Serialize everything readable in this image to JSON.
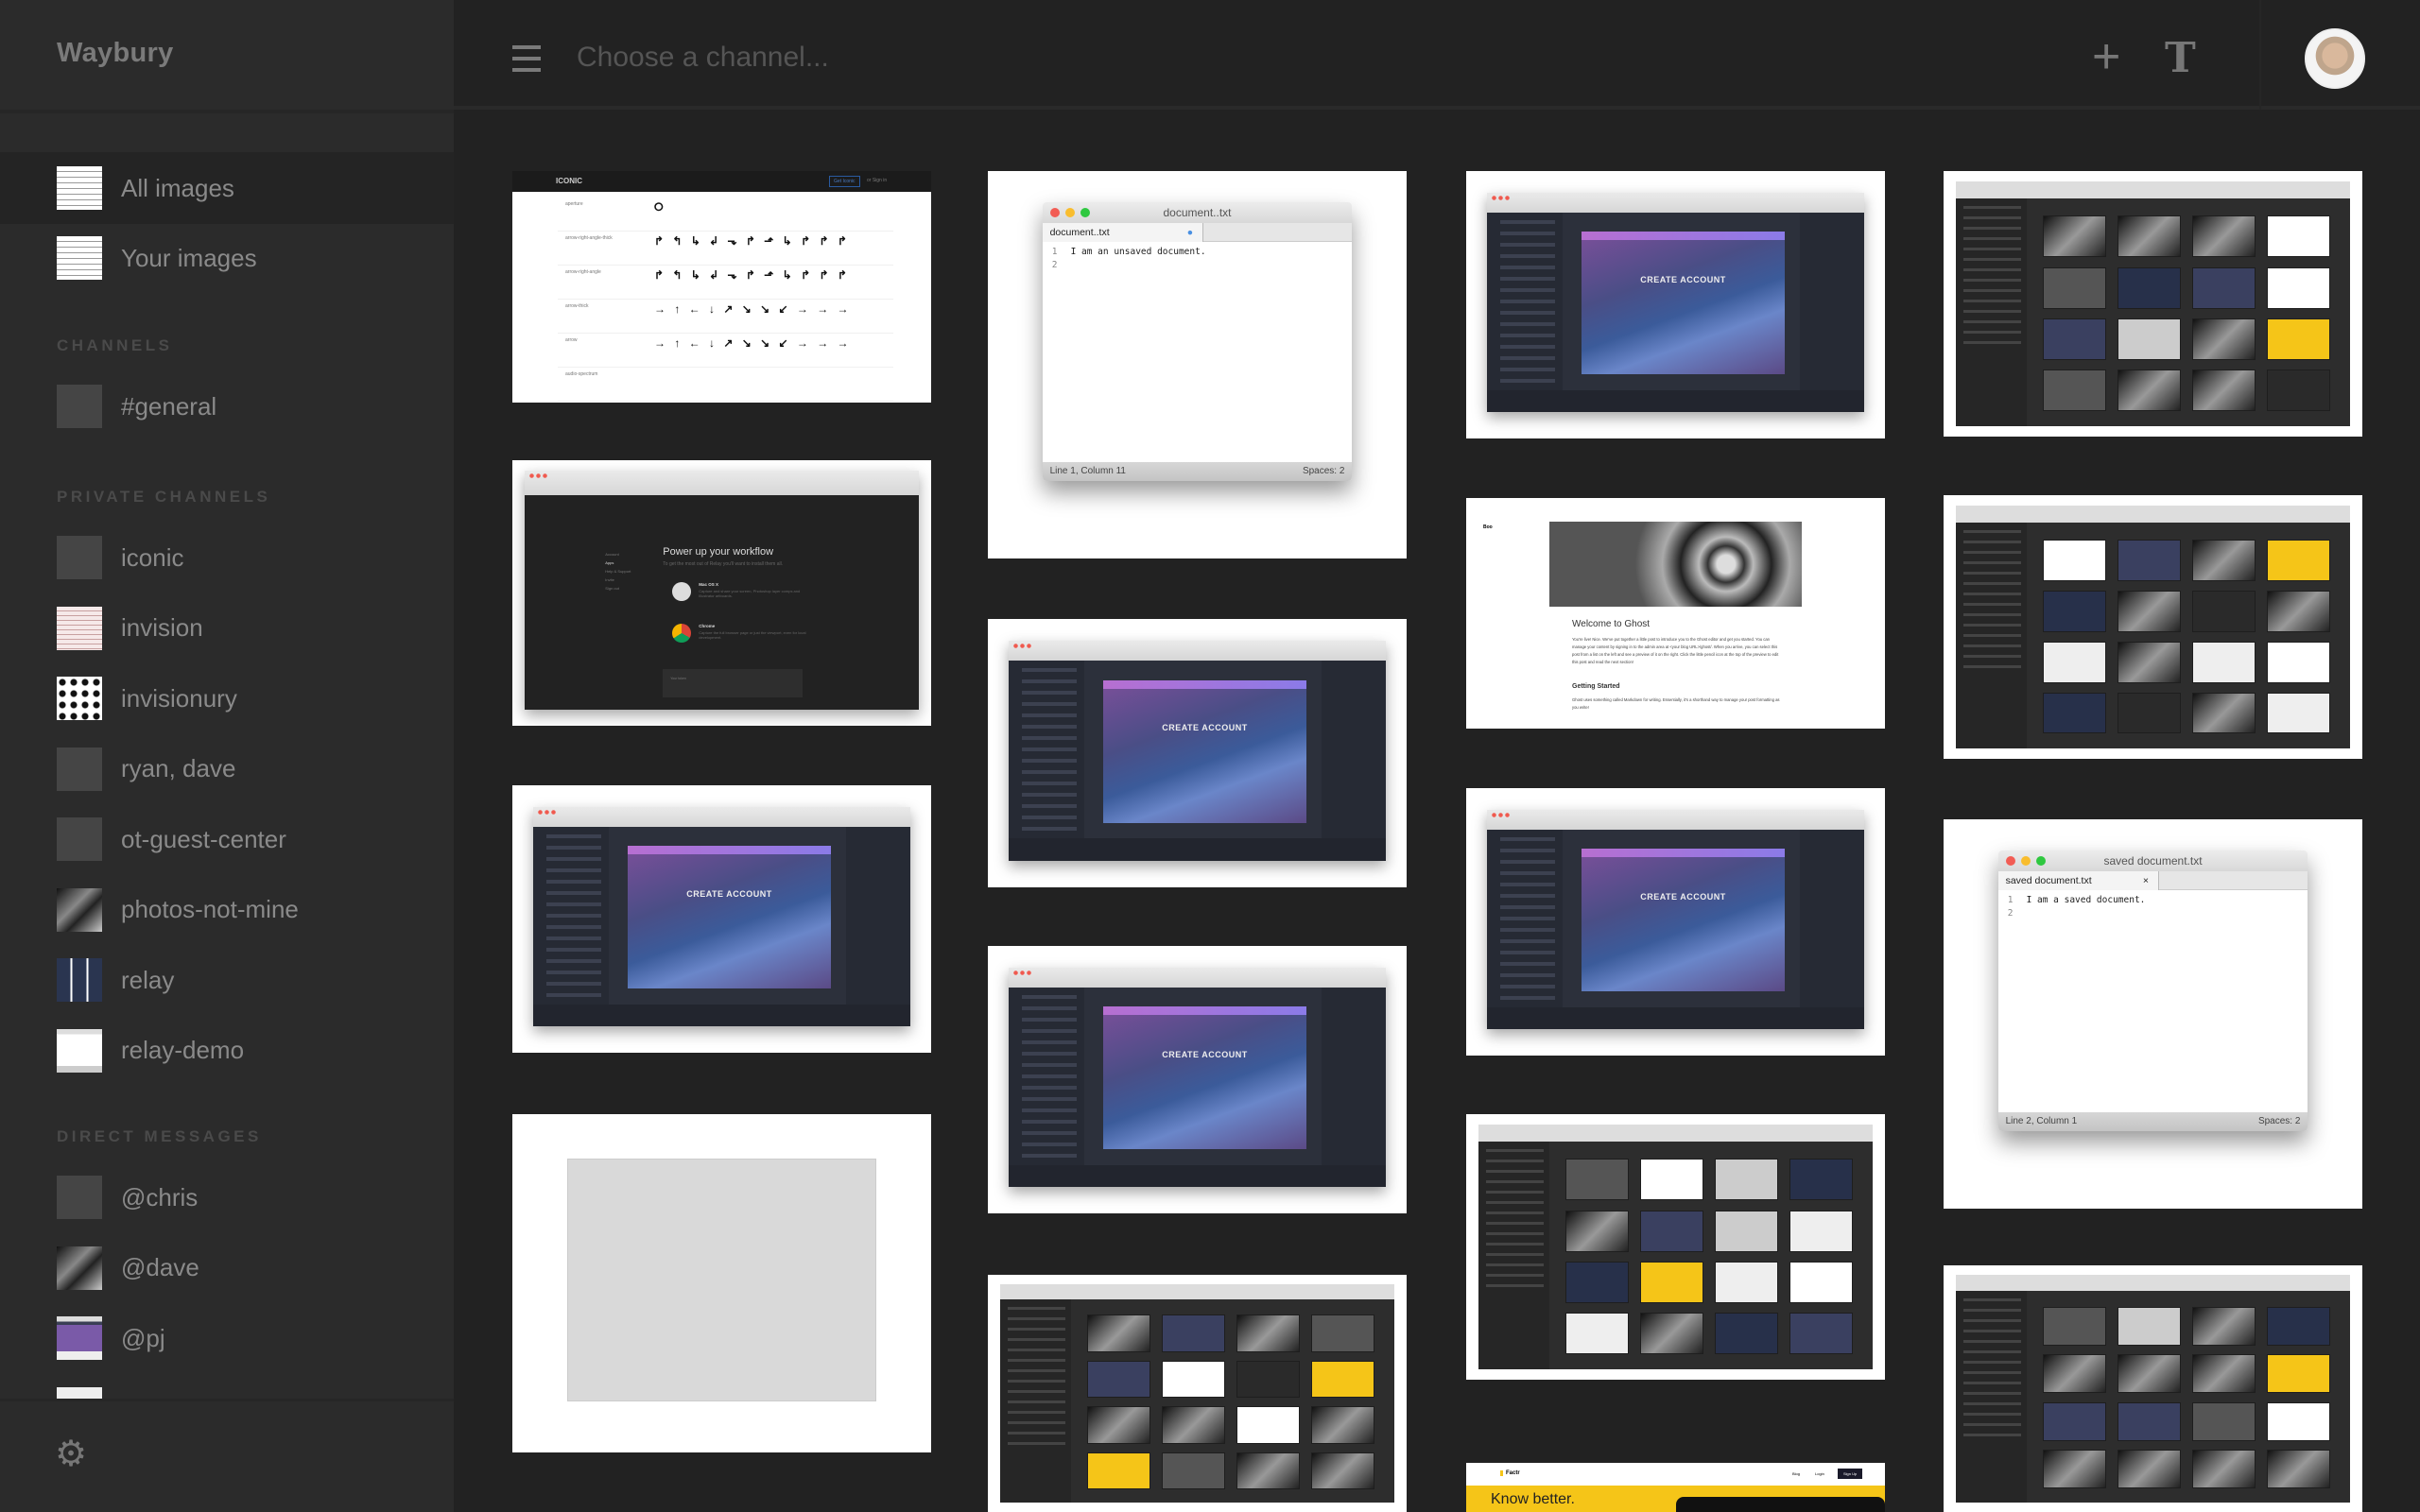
{
  "app": {
    "brand": "Waybury"
  },
  "header": {
    "channel_placeholder": "Choose a channel...",
    "add_icon": "plus-icon",
    "text_icon": "T"
  },
  "sidebar": {
    "top_items": [
      {
        "label": "All images",
        "active": true,
        "thumb": "iconic"
      },
      {
        "label": "Your images",
        "active": false,
        "thumb": "iconic"
      }
    ],
    "sections": [
      {
        "title": "CHANNELS",
        "items": [
          {
            "label": "#general",
            "thumb": "none"
          }
        ]
      },
      {
        "title": "PRIVATE CHANNELS",
        "items": [
          {
            "label": "iconic",
            "thumb": "none"
          },
          {
            "label": "invision",
            "thumb": "invision"
          },
          {
            "label": "invisionury",
            "thumb": "grid"
          },
          {
            "label": "ryan, dave",
            "thumb": "none"
          },
          {
            "label": "ot-guest-center",
            "thumb": "none"
          },
          {
            "label": "photos-not-mine",
            "thumb": "photo"
          },
          {
            "label": "relay",
            "thumb": "relay"
          },
          {
            "label": "relay-demo",
            "thumb": "doc"
          }
        ]
      },
      {
        "title": "DIRECT MESSAGES",
        "items": [
          {
            "label": "@chris",
            "thumb": "none"
          },
          {
            "label": "@dave",
            "thumb": "photo"
          },
          {
            "label": "@pj",
            "thumb": "purple"
          }
        ]
      }
    ],
    "settings_icon": "gear-icon"
  },
  "colors": {
    "sidebar_bg": "#2b2b2b",
    "main_bg": "#222222",
    "text": "#8a8a8a",
    "section": "#4a4a4a"
  },
  "images": [
    {
      "type": "iconic",
      "brand": "ICONIC",
      "cta": "Get Iconic",
      "signin": "or Sign in",
      "rows": [
        {
          "name": "aperture",
          "glyphs": "⭘"
        },
        {
          "name": "arrow-right-angle-thick",
          "glyphs": "↱ ↰ ↳ ↲ ⬎ ↱ ⬏ ↳ ↱ ↱ ↱"
        },
        {
          "name": "arrow-right-angle",
          "glyphs": "↱ ↰ ↳ ↲ ⬎ ↱ ⬏ ↳ ↱ ↱ ↱"
        },
        {
          "name": "arrow-thick",
          "glyphs": "→ ↑ ← ↓ ↗ ↘ ↘ ↙ → → →"
        },
        {
          "name": "arrow",
          "glyphs": "→ ↑ ← ↓ ↗ ↘ ↘ ↙ → → →"
        },
        {
          "name": "audio-spectrum",
          "glyphs": ""
        }
      ]
    },
    {
      "type": "power",
      "title": "Power up your workflow",
      "subtitle": "To get the most out of Relay you'll want to install them all.",
      "menu": [
        "Account",
        "Apps",
        "Help & Support",
        "Invite",
        "Sign out"
      ],
      "apps": [
        {
          "name": "Mac OS X",
          "desc": "Capture and share your screen, Photoshop layer comps and Illustrator artboards."
        },
        {
          "name": "Chrome",
          "desc": "Capture the full browser page or just the viewport, even for local development."
        }
      ],
      "token_label": "Your token"
    },
    {
      "type": "invision",
      "title": "CREATE ACCOUNT"
    },
    {
      "type": "blank"
    },
    {
      "type": "doc",
      "window_title": "document..txt",
      "tab": "document..txt",
      "tab_mark": "●",
      "lines": [
        "I am an unsaved document.",
        ""
      ],
      "status_left": "Line 1, Column 11",
      "status_right": "Spaces: 2"
    },
    {
      "type": "invision",
      "title": "CREATE ACCOUNT"
    },
    {
      "type": "invision",
      "title": "CREATE ACCOUNT"
    },
    {
      "type": "relay"
    },
    {
      "type": "invision",
      "title": "CREATE ACCOUNT"
    },
    {
      "type": "ghost",
      "site": "Boo",
      "title": "Welcome to Ghost",
      "body": "You're live! Nice. We've put together a little post to introduce you to the Ghost editor and get you started. You can manage your content by signing in to the admin area at <your blog URL>/ghost/. When you arrive, you can select this post from a list on the left and see a preview of it on the right. Click the little pencil icon at the top of the preview to edit this post and read the next section!",
      "h2": "Getting Started",
      "body2": "Ghost uses something called Markdown for writing. Essentially, it's a shorthand way to manage your post formatting as you write!"
    },
    {
      "type": "invision",
      "title": "CREATE ACCOUNT"
    },
    {
      "type": "relay"
    },
    {
      "type": "factr",
      "brand": "Factr",
      "nav": [
        "Blog",
        "Login"
      ],
      "cta": "Sign Up",
      "headline": "Know better."
    },
    {
      "type": "relay"
    },
    {
      "type": "relay"
    },
    {
      "type": "doc",
      "window_title": "saved document.txt",
      "tab": "saved document.txt",
      "tab_mark": "×",
      "lines": [
        "I am a saved document.",
        ""
      ],
      "status_left": "Line 2, Column 1",
      "status_right": "Spaces: 2"
    },
    {
      "type": "relay"
    }
  ]
}
